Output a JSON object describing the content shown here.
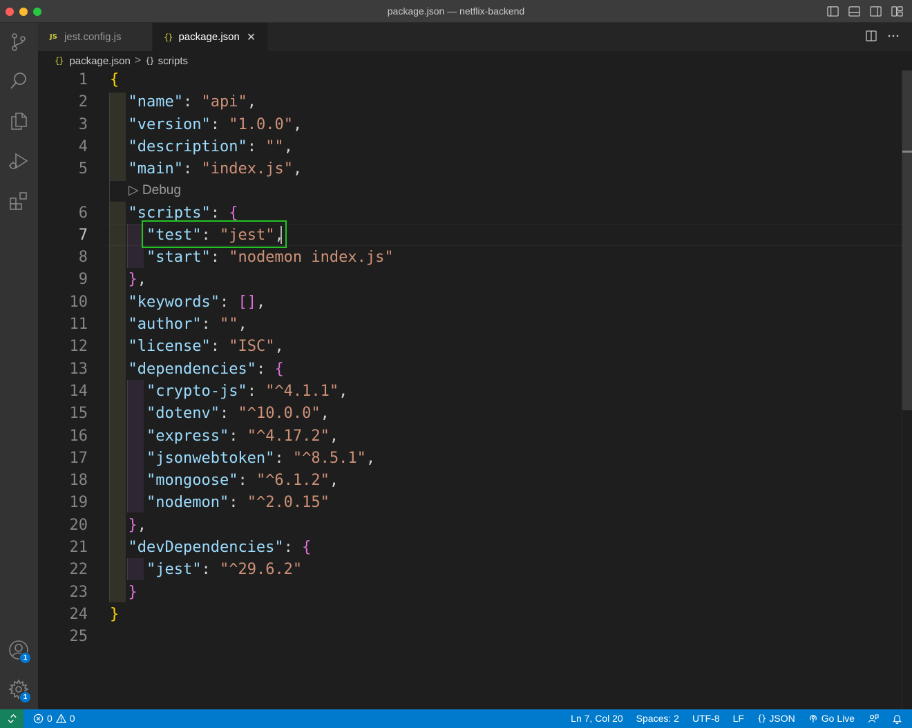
{
  "window": {
    "title": "package.json — netflix-backend"
  },
  "activity_bar": {
    "items": [
      {
        "name": "source-control-icon"
      },
      {
        "name": "search-icon"
      },
      {
        "name": "explorer-icon"
      },
      {
        "name": "run-debug-icon"
      },
      {
        "name": "extensions-icon"
      }
    ],
    "accounts_badge": "1",
    "settings_badge": "1"
  },
  "tabs": [
    {
      "label": "jest.config.js",
      "icon_text": "JS",
      "active": false
    },
    {
      "label": "package.json",
      "icon_text": "{}",
      "active": true
    }
  ],
  "breadcrumb": {
    "file_icon": "{}",
    "file": "package.json",
    "separator": ">",
    "symbol_icon": "{}",
    "symbol": "scripts"
  },
  "editor": {
    "codelens": "Debug",
    "codelens_icon": "▷",
    "active_line": 7,
    "lines": [
      {
        "n": "1",
        "tokens": [
          [
            "b1",
            "{"
          ]
        ]
      },
      {
        "n": "2",
        "tokens": [
          [
            "p",
            "  "
          ],
          [
            "k",
            "\"name\""
          ],
          [
            "p",
            ": "
          ],
          [
            "s",
            "\"api\""
          ],
          [
            "p",
            ","
          ]
        ]
      },
      {
        "n": "3",
        "tokens": [
          [
            "p",
            "  "
          ],
          [
            "k",
            "\"version\""
          ],
          [
            "p",
            ": "
          ],
          [
            "s",
            "\"1.0.0\""
          ],
          [
            "p",
            ","
          ]
        ]
      },
      {
        "n": "4",
        "tokens": [
          [
            "p",
            "  "
          ],
          [
            "k",
            "\"description\""
          ],
          [
            "p",
            ": "
          ],
          [
            "s",
            "\"\""
          ],
          [
            "p",
            ","
          ]
        ]
      },
      {
        "n": "5",
        "tokens": [
          [
            "p",
            "  "
          ],
          [
            "k",
            "\"main\""
          ],
          [
            "p",
            ": "
          ],
          [
            "s",
            "\"index.js\""
          ],
          [
            "p",
            ","
          ]
        ]
      },
      {
        "n": "6",
        "tokens": [
          [
            "p",
            "  "
          ],
          [
            "k",
            "\"scripts\""
          ],
          [
            "p",
            ": "
          ],
          [
            "b2",
            "{"
          ]
        ]
      },
      {
        "n": "7",
        "tokens": [
          [
            "p",
            "    "
          ],
          [
            "k",
            "\"test\""
          ],
          [
            "p",
            ": "
          ],
          [
            "s",
            "\"jest\""
          ],
          [
            "p",
            ","
          ]
        ]
      },
      {
        "n": "8",
        "tokens": [
          [
            "p",
            "    "
          ],
          [
            "k",
            "\"start\""
          ],
          [
            "p",
            ": "
          ],
          [
            "s",
            "\"nodemon index.js\""
          ]
        ]
      },
      {
        "n": "9",
        "tokens": [
          [
            "p",
            "  "
          ],
          [
            "b2",
            "}"
          ],
          [
            "p",
            ","
          ]
        ]
      },
      {
        "n": "10",
        "tokens": [
          [
            "p",
            "  "
          ],
          [
            "k",
            "\"keywords\""
          ],
          [
            "p",
            ": "
          ],
          [
            "b2",
            "[]"
          ],
          [
            "p",
            ","
          ]
        ]
      },
      {
        "n": "11",
        "tokens": [
          [
            "p",
            "  "
          ],
          [
            "k",
            "\"author\""
          ],
          [
            "p",
            ": "
          ],
          [
            "s",
            "\"\""
          ],
          [
            "p",
            ","
          ]
        ]
      },
      {
        "n": "12",
        "tokens": [
          [
            "p",
            "  "
          ],
          [
            "k",
            "\"license\""
          ],
          [
            "p",
            ": "
          ],
          [
            "s",
            "\"ISC\""
          ],
          [
            "p",
            ","
          ]
        ]
      },
      {
        "n": "13",
        "tokens": [
          [
            "p",
            "  "
          ],
          [
            "k",
            "\"dependencies\""
          ],
          [
            "p",
            ": "
          ],
          [
            "b2",
            "{"
          ]
        ]
      },
      {
        "n": "14",
        "tokens": [
          [
            "p",
            "    "
          ],
          [
            "k",
            "\"crypto-js\""
          ],
          [
            "p",
            ": "
          ],
          [
            "s",
            "\"^4.1.1\""
          ],
          [
            "p",
            ","
          ]
        ]
      },
      {
        "n": "15",
        "tokens": [
          [
            "p",
            "    "
          ],
          [
            "k",
            "\"dotenv\""
          ],
          [
            "p",
            ": "
          ],
          [
            "s",
            "\"^10.0.0\""
          ],
          [
            "p",
            ","
          ]
        ]
      },
      {
        "n": "16",
        "tokens": [
          [
            "p",
            "    "
          ],
          [
            "k",
            "\"express\""
          ],
          [
            "p",
            ": "
          ],
          [
            "s",
            "\"^4.17.2\""
          ],
          [
            "p",
            ","
          ]
        ]
      },
      {
        "n": "17",
        "tokens": [
          [
            "p",
            "    "
          ],
          [
            "k",
            "\"jsonwebtoken\""
          ],
          [
            "p",
            ": "
          ],
          [
            "s",
            "\"^8.5.1\""
          ],
          [
            "p",
            ","
          ]
        ]
      },
      {
        "n": "18",
        "tokens": [
          [
            "p",
            "    "
          ],
          [
            "k",
            "\"mongoose\""
          ],
          [
            "p",
            ": "
          ],
          [
            "s",
            "\"^6.1.2\""
          ],
          [
            "p",
            ","
          ]
        ]
      },
      {
        "n": "19",
        "tokens": [
          [
            "p",
            "    "
          ],
          [
            "k",
            "\"nodemon\""
          ],
          [
            "p",
            ": "
          ],
          [
            "s",
            "\"^2.0.15\""
          ]
        ]
      },
      {
        "n": "20",
        "tokens": [
          [
            "p",
            "  "
          ],
          [
            "b2",
            "}"
          ],
          [
            "p",
            ","
          ]
        ]
      },
      {
        "n": "21",
        "tokens": [
          [
            "p",
            "  "
          ],
          [
            "k",
            "\"devDependencies\""
          ],
          [
            "p",
            ": "
          ],
          [
            "b2",
            "{"
          ]
        ]
      },
      {
        "n": "22",
        "tokens": [
          [
            "p",
            "    "
          ],
          [
            "k",
            "\"jest\""
          ],
          [
            "p",
            ": "
          ],
          [
            "s",
            "\"^29.6.2\""
          ]
        ]
      },
      {
        "n": "23",
        "tokens": [
          [
            "p",
            "  "
          ],
          [
            "b2",
            "}"
          ]
        ]
      },
      {
        "n": "24",
        "tokens": [
          [
            "b1",
            "}"
          ]
        ]
      },
      {
        "n": "25",
        "tokens": []
      }
    ]
  },
  "status_bar": {
    "errors": "0",
    "warnings": "0",
    "position": "Ln 7, Col 20",
    "indent": "Spaces: 2",
    "encoding": "UTF-8",
    "eol": "LF",
    "language_icon": "{}",
    "language": "JSON",
    "go_live": "Go Live"
  },
  "colors": {
    "status_bar": "#007acc",
    "remote": "#16825d",
    "highlight_box": "#22c322",
    "json_key": "#9cdcfe",
    "json_string": "#ce9178"
  }
}
